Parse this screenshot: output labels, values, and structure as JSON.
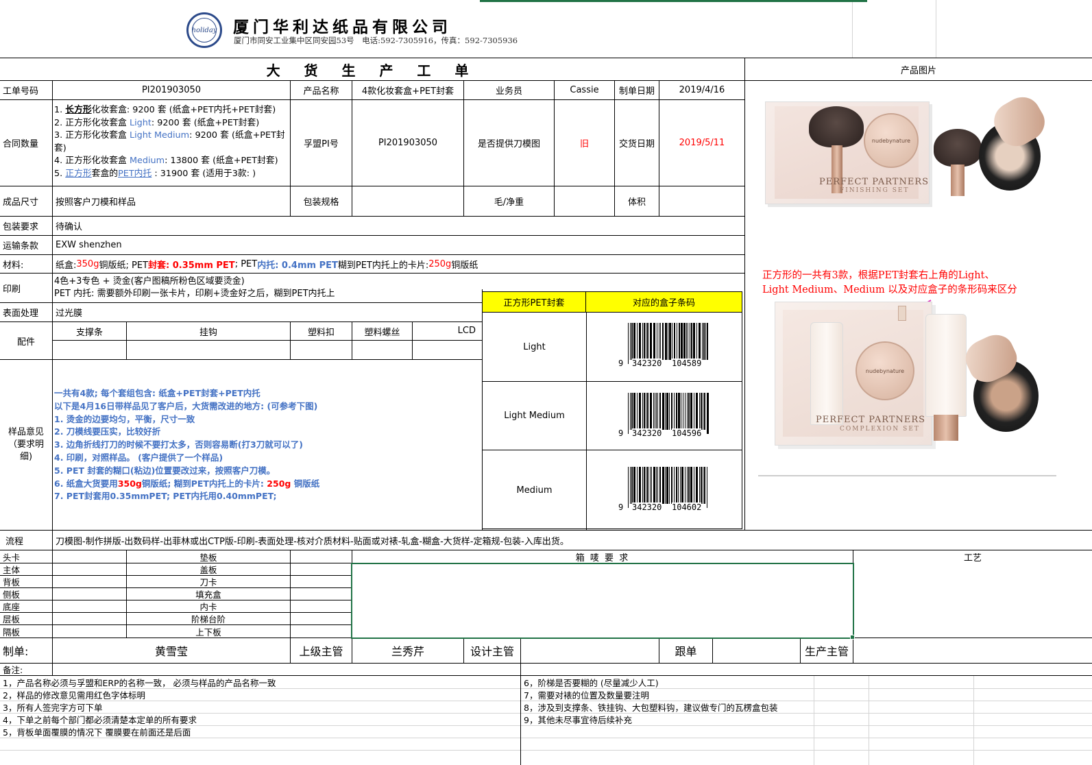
{
  "company": {
    "name": "厦门华利达纸品有限公司",
    "address_line": "厦门市同安工业集中区同安园53号　电话:592-7305916，传真：592-7305936",
    "logo_text": "holiday"
  },
  "form_title": "大 货 生 产 工 单",
  "image_section_title": "产品图片",
  "header_row": {
    "order_no_label": "工单号码",
    "order_no": "PI201903050",
    "product_name_label": "产品名称",
    "product_name": "4款化妆套盒+PET封套",
    "salesperson_label": "业务员",
    "salesperson": "Cassie",
    "order_date_label": "制单日期",
    "order_date": "2019/4/16"
  },
  "contract": {
    "label": "合同数量",
    "line1_pre": "1. ",
    "line1_b": "长方形",
    "line1_post": "化妆套盒: 9200 套 (纸盒+PET内托+PET封套)",
    "line2_pre": "2. 正方形化妆套盒 ",
    "line2_blue": "Light",
    "line2_post": ": 9200 套 (纸盒+PET封套)",
    "line3_pre": "3. 正方形化妆套盒 ",
    "line3_blue": "Light Medium",
    "line3_post": ": 9200 套 (纸盒+PET封",
    "line3b": "套)",
    "line4_pre": "4. 正方形化妆套盒 ",
    "line4_blue": "Medium",
    "line4_post": ": 13800 套  (纸盒+PET封套)",
    "line5_pre": "5. ",
    "line5_blue": "正方形",
    "line5_mid": "套盒的",
    "line5_blue2": "PET内托",
    "line5_post": " : 31900 套  (适用于3款: )",
    "ref_label": "孚盟PI号",
    "ref_value": "PI201903050",
    "die_label": "是否提供刀模图",
    "die_value": "旧",
    "delivery_label": "交货日期",
    "delivery_value": "2019/5/11"
  },
  "size_row": {
    "label": "成品尺寸",
    "value": "按照客户刀模和样品",
    "pack_label": "包装规格",
    "weight_label": "毛/净重",
    "volume_label": "体积"
  },
  "pack_req": {
    "label": "包装要求",
    "value": "待确认"
  },
  "shipping": {
    "label": "运输条款",
    "value": "EXW shenzhen"
  },
  "material": {
    "label": "材料:",
    "p1": "纸盒: ",
    "p1r": "350g",
    "p1b": " 铜版纸;   PET",
    "p2r": "封套: 0.35mm PET",
    "p3": ";   PET ",
    "p3b": "内托: 0.4mm PET",
    "p4": "     糊到PET内托上的卡片: ",
    "p4r": "250g",
    "p5": " 铜版纸"
  },
  "printing": {
    "label": "印刷",
    "line1": "4色+3专色 + 烫金(客户图稿所粉色区域要烫金)",
    "line2": "PET 内托:  需要额外印刷一张卡片，印刷+烫金好之后，糊到PET内托上"
  },
  "surface": {
    "label": "表面处理",
    "value": "过光膜"
  },
  "accessories": {
    "label": "配件",
    "cols": [
      "支撑条",
      "挂钩",
      "塑料扣",
      "塑料螺丝",
      "LCD"
    ]
  },
  "sample_notes": {
    "label_1": "样品意见",
    "label_2": "（要求明",
    "label_3": "细)",
    "lines": [
      "一共有4款;   每个套组包含: 纸盒+PET封套+PET内托",
      "以下是4月16日带样品见了客户后，大货需改进的地方: (可参考下图)",
      "1. 烫金的边要均匀，平衡，尺寸一致",
      "2. 刀模线要压实，比较好折",
      "3. 边角折线打刀的时候不要打太多，否则容易断(打3刀就可以了)",
      "4. 印刷，对照样品。   (客户提供了一个样品)",
      "5. PET 封套的糊口(粘边)位置要改过来，按照客户刀模。"
    ],
    "line6_pre": "6. 纸盒大货要用",
    "line6_r1": "350g",
    "line6_mid": "铜版纸;  糊到PET内托上的卡片: ",
    "line6_r2": "250g",
    "line6_post": " 铜版纸",
    "line7": "7. PET封套用0.35mmPET;   PET内托用0.40mmPET;"
  },
  "barcode_table": {
    "header_1": "正方形PET封套",
    "header_2": "对应的盒子条码",
    "header_bg": "#ffff00",
    "rows": [
      {
        "name": "Light",
        "prefix": "9",
        "code1": "342320",
        "code2": "104589"
      },
      {
        "name": "Light Medium",
        "prefix": "9",
        "code1": "342320",
        "code2": "104596"
      },
      {
        "name": "Medium",
        "prefix": "9",
        "code1": "342320",
        "code2": "104602"
      }
    ]
  },
  "images": {
    "product1_brand": "nudebynature",
    "product1_title": "PERFECT PARTNERS",
    "product1_sub": "FINISHING SET",
    "annotation_line1": "正方形的一共有3款，根据PET封套右上角的Light、",
    "annotation_line2": "Light Medium、Medium 以及对应盒子的条形码来区分",
    "annotation_color": "#ff0000",
    "product2_brand": "nudebynature",
    "product2_title": "PERFECT PARTNERS",
    "product2_sub": "COMPLEXION SET"
  },
  "process": {
    "label": "流程",
    "value": "刀模图-制作拼版-出数码样-出菲林或出CTP版-印刷-表面处理-核对介质材料-贴面或对裱-轧盒-糊盒-大货样-定箱规-包装-入库出货。"
  },
  "parts": {
    "left": [
      "头卡",
      "主体",
      "背板",
      "侧板",
      "底座",
      "层板",
      "隔板"
    ],
    "mid": [
      "垫板",
      "盖板",
      "刀卡",
      "填充盒",
      "内卡",
      "阶梯台阶",
      "上下板"
    ],
    "box_label": "箱 唛 要 求",
    "craft_label": "工艺"
  },
  "signatures": {
    "maker_label": "制单:",
    "maker": "黄雪莹",
    "supervisor_label": "上级主管",
    "supervisor": "兰秀芹",
    "design_label": "设计主管",
    "follow_label": "跟单",
    "prod_label": "生产主管"
  },
  "remarks": {
    "label": "备注:",
    "left": [
      "1，产品名称必须与孚盟和ERP的名称一致，  必须与样品的产品名称一致",
      "2，样品的修改意见需用红色字体标明",
      "3，所有人签完字方可下单",
      "4，下单之前每个部门都必须清楚本定单的所有要求",
      "5，背板单面覆膜的情况下 覆膜要在前面还是后面"
    ],
    "right": [
      "6，阶梯是否要糊的  (尽量减少人工)",
      "7，需要对裱的位置及数量要注明",
      "8，涉及到支撑条、铁挂钩、大包塑料钩，建议做专门的瓦楞盒包装",
      "9，其他未尽事宜待后续补充"
    ]
  },
  "colors": {
    "blue_text": "#4472c4",
    "red_text": "#ff0000",
    "selection_green": "#217346"
  }
}
